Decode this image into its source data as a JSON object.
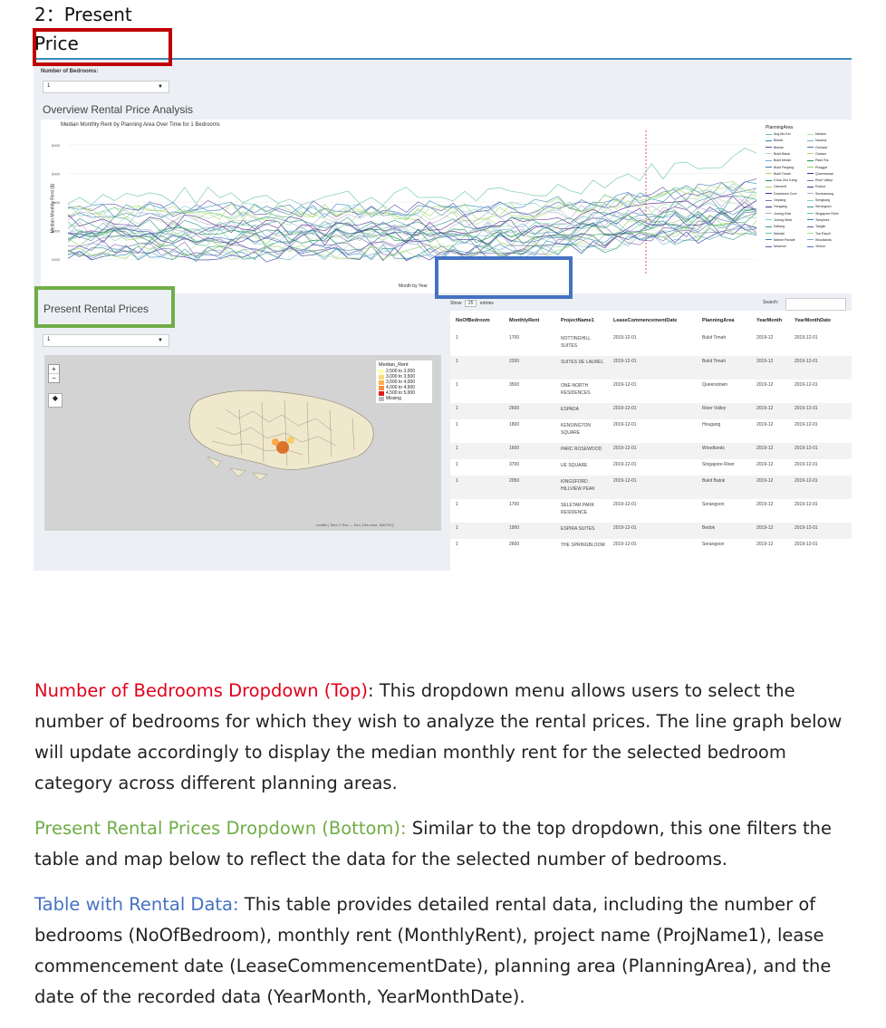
{
  "heading": {
    "number": "2：Present",
    "title": "Price"
  },
  "app": {
    "bedroom_label": "Number of Bedrooms:",
    "bedroom_value": "1",
    "overview_title": "Overview Rental Price Analysis",
    "chart_title": "Median Monthly Rent by Planning Area Over Time for 1 Bedrooms",
    "present_title": "Present Rental Prices",
    "present_value": "1",
    "show_label": "Show",
    "show_value": "25",
    "entries_label": "entries",
    "search_label": "Search:",
    "attribution": "Leaflet | Tiles © Esri — Esri, DeLorme, NAVTEQ"
  },
  "chart_data": {
    "type": "line",
    "title": "Median Monthly Rent by Planning Area Over Time for 1 Bedrooms",
    "xlabel": "Month by Year",
    "ylabel": "Median Monthly Rent ($)",
    "yticks": [
      "2000",
      "3000",
      "4000",
      "5000",
      "6000"
    ],
    "ylim": [
      1500,
      6500
    ],
    "legend_title": "PlanningArea",
    "legend": [
      "Ang Mo Kio",
      "Bedok",
      "Bishan",
      "Bukit Batok",
      "Bukit Merah",
      "Bukit Panjang",
      "Bukit Timah",
      "Choa Chu Kang",
      "Clementi",
      "Downtown Core",
      "Geylang",
      "Hougang",
      "Jurong East",
      "Jurong West",
      "Kallang",
      "Mandai",
      "Marine Parade",
      "Museum",
      "Newton",
      "Novena",
      "Orchard",
      "Outram",
      "Pasir Ris",
      "Punggol",
      "Queenstown",
      "River Valley",
      "Rochor",
      "Sembawang",
      "Sengkang",
      "Serangoon",
      "Singapore River",
      "Tampines",
      "Tanglin",
      "Toa Payoh",
      "Woodlands",
      "Yishun"
    ]
  },
  "map_legend": {
    "title": "Median_Rent",
    "items": [
      {
        "label": "2,500 to 3,000",
        "color": "#ffffb2"
      },
      {
        "label": "3,000 to 3,500",
        "color": "#fed976"
      },
      {
        "label": "3,500 to 4,000",
        "color": "#feb24c"
      },
      {
        "label": "4,000 to 4,500",
        "color": "#fd8d3c"
      },
      {
        "label": "4,500 to 5,000",
        "color": "#e31a1c"
      },
      {
        "label": "Missing",
        "color": "#bdbdbd"
      }
    ]
  },
  "table": {
    "columns": [
      "NoOfBedroom",
      "MonthlyRent",
      "ProjectName1",
      "LeaseCommencementDate",
      "PlanningArea",
      "YearMonth",
      "YearMonthDate"
    ],
    "rows": [
      [
        "1",
        "1700",
        "NOTTINGHILL SUITES",
        "2019-12-01",
        "Bukit Timah",
        "2019-12",
        "2019-12-01"
      ],
      [
        "1",
        "2200",
        "SUITES DE LAUREL",
        "2019-12-01",
        "Bukit Timah",
        "2019-12",
        "2019-12-01"
      ],
      [
        "1",
        "3500",
        "ONE-NORTH RESIDENCES",
        "2019-12-01",
        "Queenstown",
        "2019-12",
        "2019-12-01"
      ],
      [
        "1",
        "2600",
        "ESPADA",
        "2019-12-01",
        "River Valley",
        "2019-12",
        "2019-12-01"
      ],
      [
        "1",
        "1800",
        "KENSINGTON SQUARE",
        "2019-12-01",
        "Hougang",
        "2019-12",
        "2019-12-01"
      ],
      [
        "1",
        "1600",
        "PARC ROSEWOOD",
        "2019-12-01",
        "Woodlands",
        "2019-12",
        "2019-12-01"
      ],
      [
        "1",
        "3700",
        "UE SQUARE",
        "2019-12-01",
        "Singapore River",
        "2019-12",
        "2019-12-01"
      ],
      [
        "1",
        "2050",
        "KINGSFORD . HILLVIEW PEAK",
        "2019-12-01",
        "Bukit Batok",
        "2019-12",
        "2019-12-01"
      ],
      [
        "1",
        "1700",
        "SELETAR PARK RESIDENCE",
        "2019-12-01",
        "Serangoon",
        "2019-12",
        "2019-12-01"
      ],
      [
        "1",
        "1900",
        "ESPIRA SUITES",
        "2019-12-01",
        "Bedok",
        "2019-12",
        "2019-12-01"
      ],
      [
        "1",
        "2600",
        "THE SPRINGBLOOM",
        "2019-12-01",
        "Serangoon",
        "2019-12",
        "2019-12-01"
      ]
    ]
  },
  "description": {
    "p1_label": "Number of Bedrooms Dropdown (Top)",
    "p1_text": ": This dropdown menu allows users to select the number of bedrooms for which they wish to analyze the rental prices. The line graph below will update accordingly to display the median monthly rent for the selected bedroom category across different planning areas.",
    "p2_label": "Present Rental Prices Dropdown (Bottom):",
    "p2_text": " Similar to the top dropdown, this one filters the table and map below to reflect the data for the selected number of bedrooms.",
    "p3_label": "Table with Rental Data:",
    "p3_text": " This table provides detailed rental data, including the number of bedrooms (NoOfBedroom), monthly rent (MonthlyRent), project name (ProjName1), lease commencement date (LeaseCommencementDate), planning area (PlanningArea), and the date of the recorded data (YearMonth, YearMonthDate)."
  }
}
